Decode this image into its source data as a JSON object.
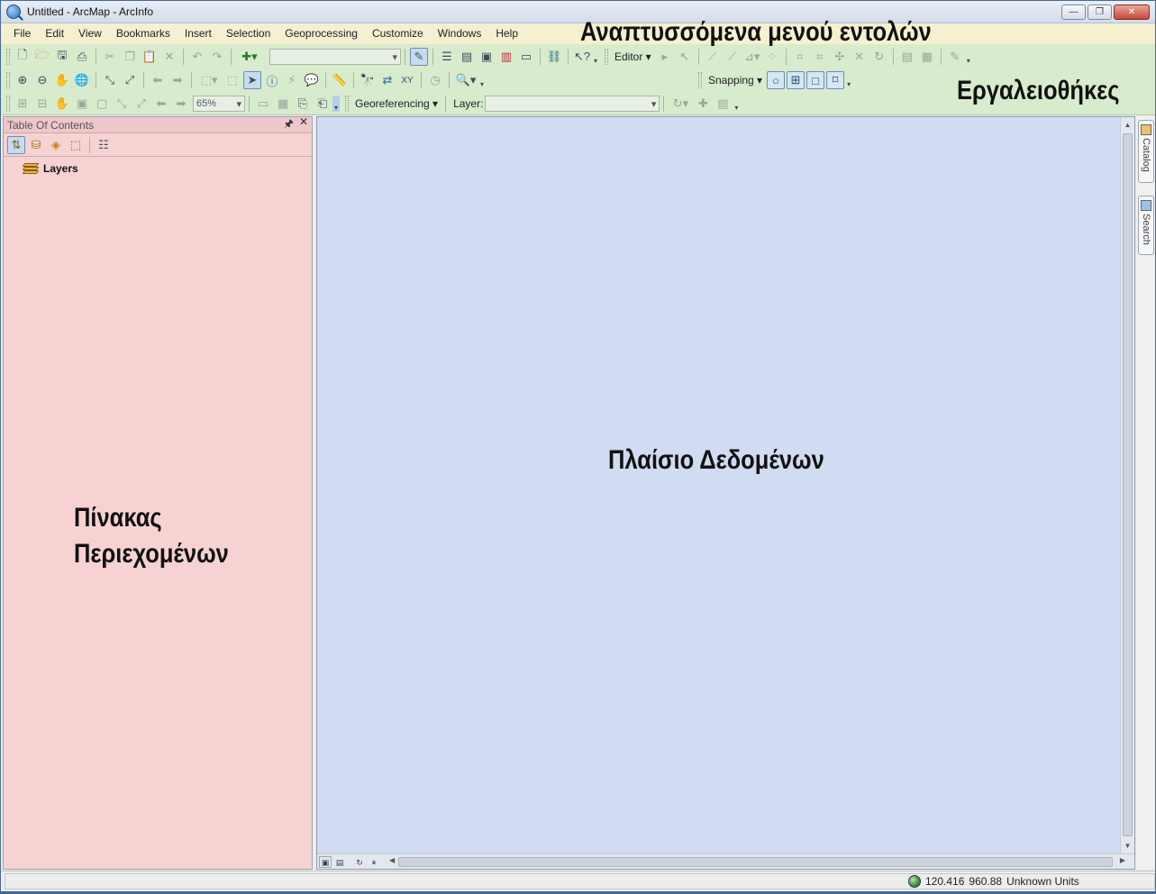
{
  "window": {
    "title": "Untitled - ArcMap - ArcInfo",
    "controls": {
      "minimize": "—",
      "maximize": "❐",
      "close": "✕"
    }
  },
  "menu": {
    "items": [
      "File",
      "Edit",
      "View",
      "Bookmarks",
      "Insert",
      "Selection",
      "Geoprocessing",
      "Customize",
      "Windows",
      "Help"
    ]
  },
  "annotations": {
    "menus": "Αναπτυσσόμενα μενού εντολών",
    "toolbars": "Εργαλειοθήκες",
    "toc_line1": "Πίνακας",
    "toc_line2": "Περιεχομένων",
    "data_frame": "Πλαίσιο Δεδομένων"
  },
  "toolbars": {
    "editor_label": "Editor ▾",
    "snapping_label": "Snapping ▾",
    "zoom_value": "65%",
    "georeferencing_label": "Georeferencing ▾",
    "layer_label": "Layer:",
    "scale_value": ""
  },
  "toc": {
    "title": "Table Of Contents",
    "pin": "🖈",
    "close": "✕",
    "root_layer": "Layers"
  },
  "dock": {
    "catalog_tab": "Catalog",
    "search_tab": "Search"
  },
  "status": {
    "coord_x": "120.416",
    "coord_y": "960.88",
    "units": "Unknown Units"
  },
  "icons": {
    "new": "new-document-icon",
    "open": "open-folder-icon",
    "save": "save-icon",
    "print": "print-icon",
    "cut": "cut-icon",
    "copy": "copy-icon",
    "paste": "paste-icon",
    "delete": "delete-icon",
    "undo": "undo-icon",
    "redo": "redo-icon",
    "add_data": "add-data-icon"
  },
  "colors": {
    "menu_bg": "#f4f0d0",
    "toolbar_bg": "#d8ebcd",
    "toc_bg": "#f7d2d2",
    "dataframe_bg": "#d1dbf1"
  }
}
